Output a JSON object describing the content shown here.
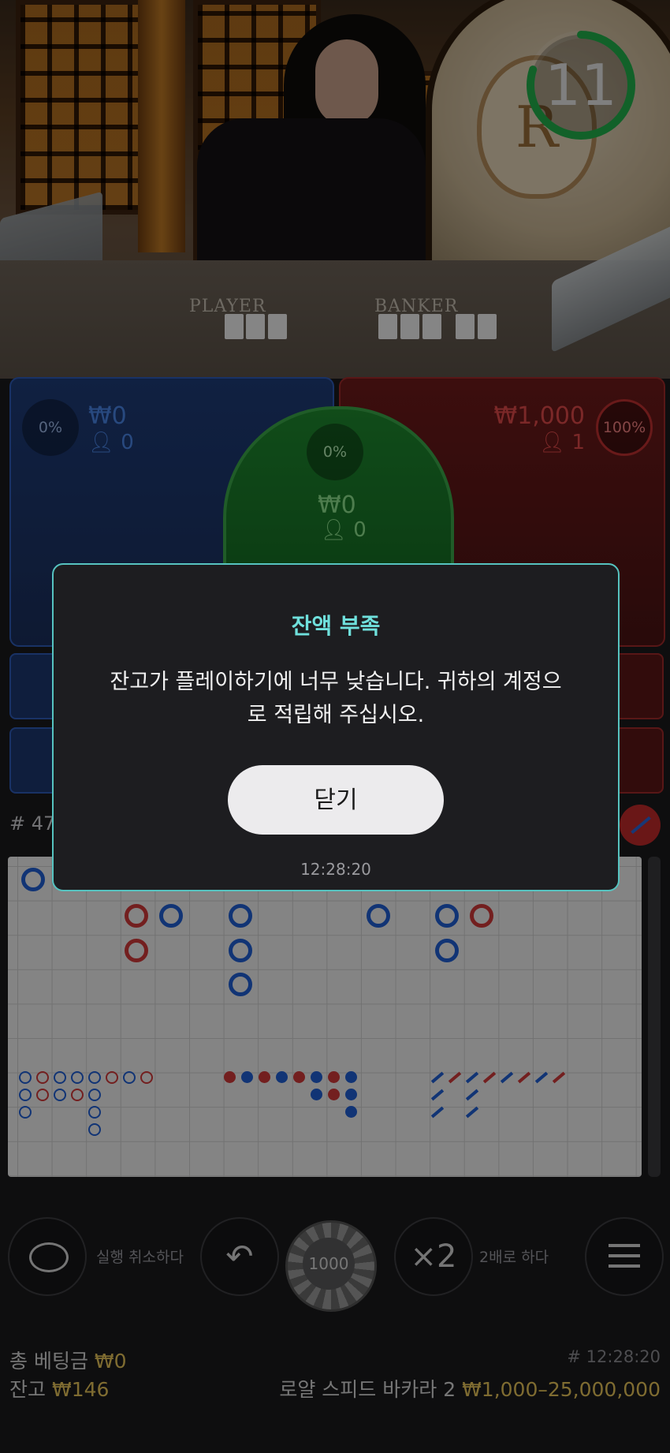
{
  "timer": {
    "seconds": "11",
    "progress": 0.8
  },
  "table": {
    "player_label": "PLAYER",
    "banker_label": "BANKER"
  },
  "bets": {
    "player": {
      "percent": "0%",
      "amount": "₩0",
      "players": "0"
    },
    "tie": {
      "percent": "0%",
      "amount": "₩0",
      "players": "0"
    },
    "banker": {
      "percent": "100%",
      "amount": "₩1,000",
      "players": "1"
    }
  },
  "road": {
    "round_prefix": "# 47"
  },
  "dialog": {
    "title": "잔액 부족",
    "message": "잔고가 플레이하기에 너무 낮습니다. 귀하의 계정으로 적립해 주십시오.",
    "close_label": "닫기",
    "time": "12:28:20"
  },
  "controls": {
    "undo_label": "실행 취소하다",
    "chip_value": "1000",
    "double_symbol": "×2",
    "double_label": "2배로 하다"
  },
  "footer": {
    "total_bet_label": "총 베팅금",
    "total_bet_value": "₩0",
    "balance_label": "잔고",
    "balance_value": "₩146",
    "round_time": "# 12:28:20",
    "game_name": "로얄 스피드 바카라 2",
    "limits": "₩1,000–25,000,000"
  },
  "colors": {
    "accent": "#6fe0dc",
    "player": "#1f5fd6",
    "banker": "#d23a3a",
    "tie": "#1f8a2f",
    "gold": "#e8c55a"
  }
}
